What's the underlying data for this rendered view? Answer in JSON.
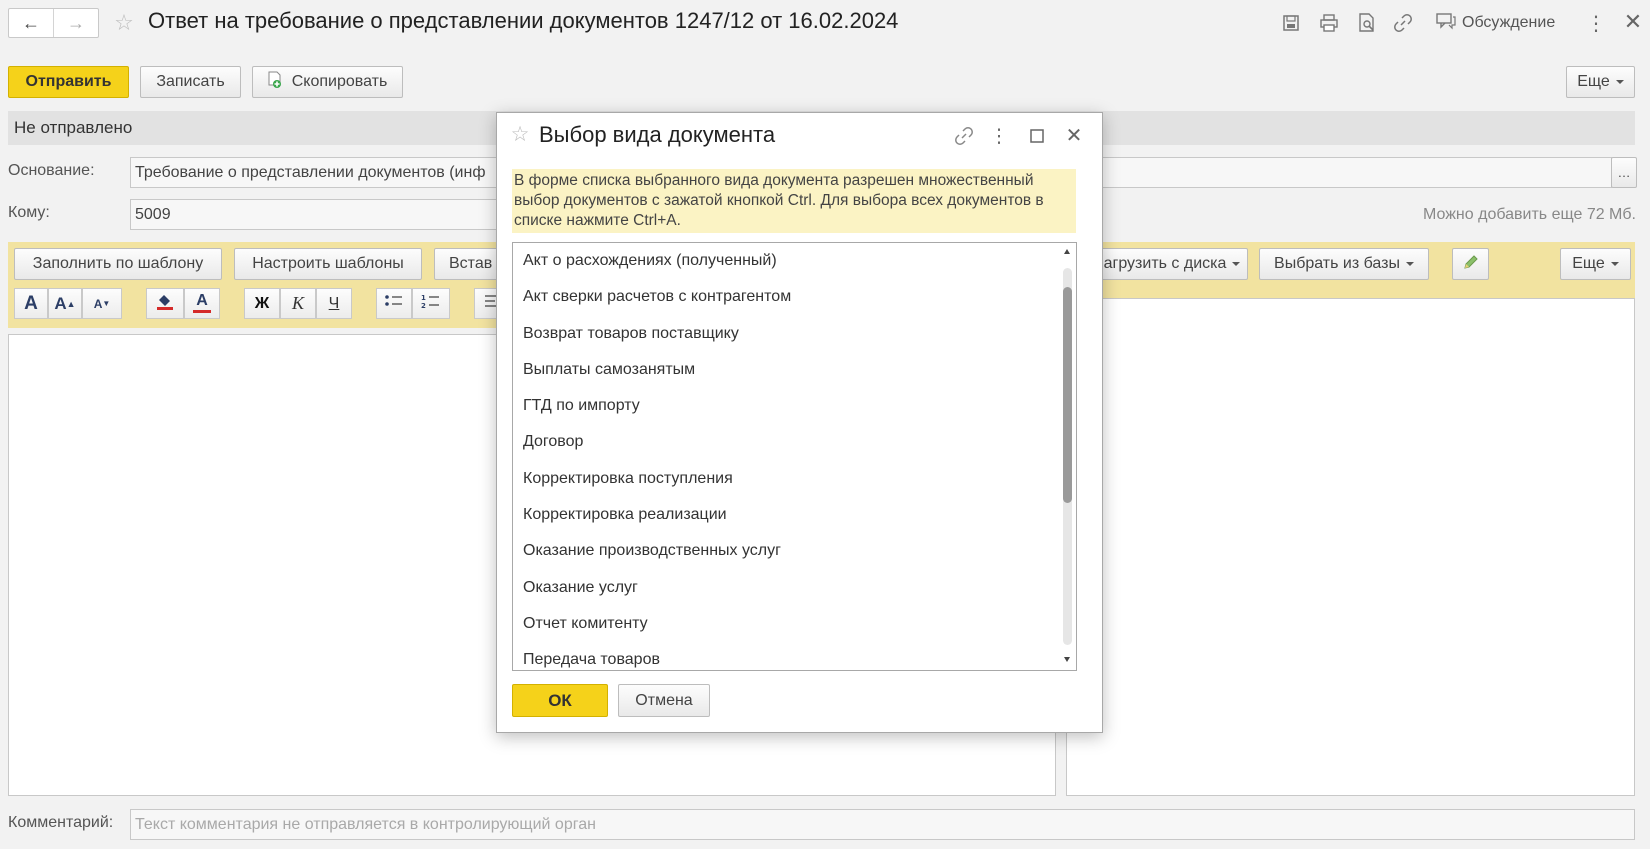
{
  "window": {
    "title": "Ответ на требование о представлении документов 1247/12 от 16.02.2024",
    "discussion_label": "Обсуждение"
  },
  "toolbar": {
    "send_label": "Отправить",
    "save_label": "Записать",
    "copy_label": "Скопировать",
    "more_label": "Еще"
  },
  "status": {
    "text": "Не отправлено"
  },
  "fields": {
    "basis_label": "Основание:",
    "basis_value": "Требование о представлении документов (инф",
    "recipient_label": "Кому:",
    "recipient_value": "5009",
    "size_note": "Можно добавить еще 72 Мб.",
    "comment_label": "Комментарий:",
    "comment_placeholder": "Текст комментария не отправляется в контролирующий орган"
  },
  "editor_toolbar": {
    "fill_template_label": "Заполнить по шаблону",
    "configure_templates_label": "Настроить шаблоны",
    "insert_label": "Встав",
    "upload_disk_label": "агрузить с диска",
    "choose_db_label": "Выбрать из базы",
    "more_label": "Еще",
    "font_a": "A",
    "bold": "Ж",
    "italic": "К",
    "underline": "Ч"
  },
  "modal": {
    "title": "Выбор вида документа",
    "hint": "В форме списка выбранного вида документа разрешен множественный выбор документов с зажатой кнопкой Ctrl. Для выбора всех документов в списке нажмите Ctrl+A.",
    "items": [
      "Акт о расхождениях (полученный)",
      "Акт сверки расчетов с контрагентом",
      "Возврат товаров поставщику",
      "Выплаты самозанятым",
      "ГТД по импорту",
      "Договор",
      "Корректировка поступления",
      "Корректировка реализации",
      "Оказание производственных услуг",
      "Оказание услуг",
      "Отчет комитенту",
      "Передача товаров"
    ],
    "ok_label": "ОК",
    "cancel_label": "Отмена"
  },
  "colors": {
    "accent_yellow": "#f5d21a",
    "toolbar_yellow": "#f2e3a0",
    "hint_background": "#fbf3c4",
    "status_bar": "#e2e2e2"
  }
}
